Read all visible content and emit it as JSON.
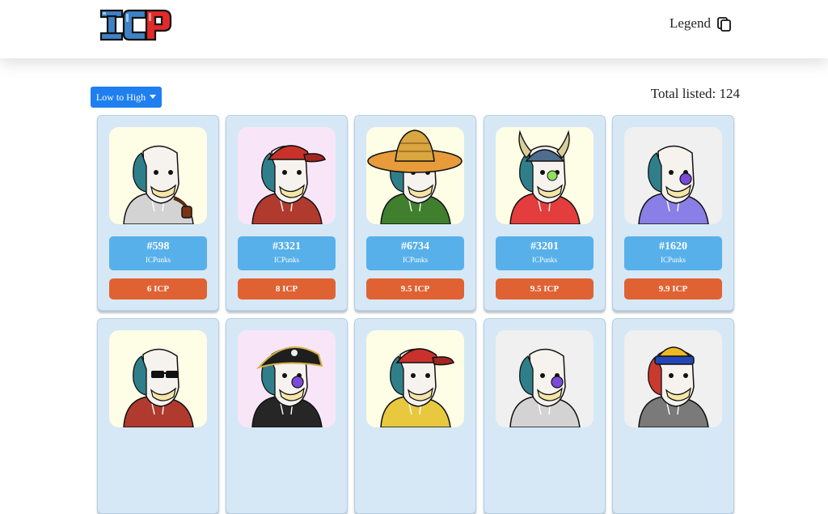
{
  "header": {
    "logo_text": "ICP",
    "legend_label": "Legend",
    "legend_icon": "copy-icon"
  },
  "toolbar": {
    "sort_label": "Low to High",
    "total_listed": "Total listed: 124"
  },
  "listings": [
    {
      "id": "#598",
      "collection": "ICPunks",
      "price": "6 ICP",
      "bg": "#fefde6",
      "hoodie": "#d3d3d3",
      "hair": "#2f7f8a",
      "accessory": "pipe"
    },
    {
      "id": "#3321",
      "collection": "ICPunks",
      "price": "8 ICP",
      "bg": "#f8e6f8",
      "hoodie": "#b03a2e",
      "hair": "#2f7f8a",
      "accessory": "red-cap"
    },
    {
      "id": "#6734",
      "collection": "ICPunks",
      "price": "9.5 ICP",
      "bg": "#fefde6",
      "hoodie": "#3f7f2e",
      "hair": "#2f7f8a",
      "accessory": "sombrero"
    },
    {
      "id": "#3201",
      "collection": "ICPunks",
      "price": "9.5 ICP",
      "bg": "#fefde6",
      "hoodie": "#e33d3d",
      "hair": "#2f7f8a",
      "accessory": "viking-helmet"
    },
    {
      "id": "#1620",
      "collection": "ICPunks",
      "price": "9.9 ICP",
      "bg": "#f0f0f0",
      "hoodie": "#8a7fe6",
      "hair": "#2f7f8a",
      "accessory": "clown-nose"
    },
    {
      "bg": "#fefde6",
      "hoodie": "#b03a2e",
      "hair": "#2f7f8a",
      "accessory": "sunglasses"
    },
    {
      "bg": "#f8e6f8",
      "hoodie": "#262626",
      "hair": "#2f7f8a",
      "accessory": "pirate-hat"
    },
    {
      "bg": "#fefde6",
      "hoodie": "#e8c83e",
      "hair": "#2f7f8a",
      "accessory": "red-cap"
    },
    {
      "bg": "#f0f0f0",
      "hoodie": "#d3d3d3",
      "hair": "#2f7f8a",
      "accessory": "clown-nose"
    },
    {
      "bg": "#f0f0f0",
      "hoodie": "#7a7a7a",
      "hair": "#c83a2e",
      "accessory": "beanie"
    }
  ],
  "colors": {
    "sort_button": "#1f7ff0",
    "card_bg": "#d6e8f5",
    "id_box": "#57b0ea",
    "price_box": "#e06232",
    "logo_blue": "#3e82c6",
    "logo_red": "#e32a2a"
  }
}
